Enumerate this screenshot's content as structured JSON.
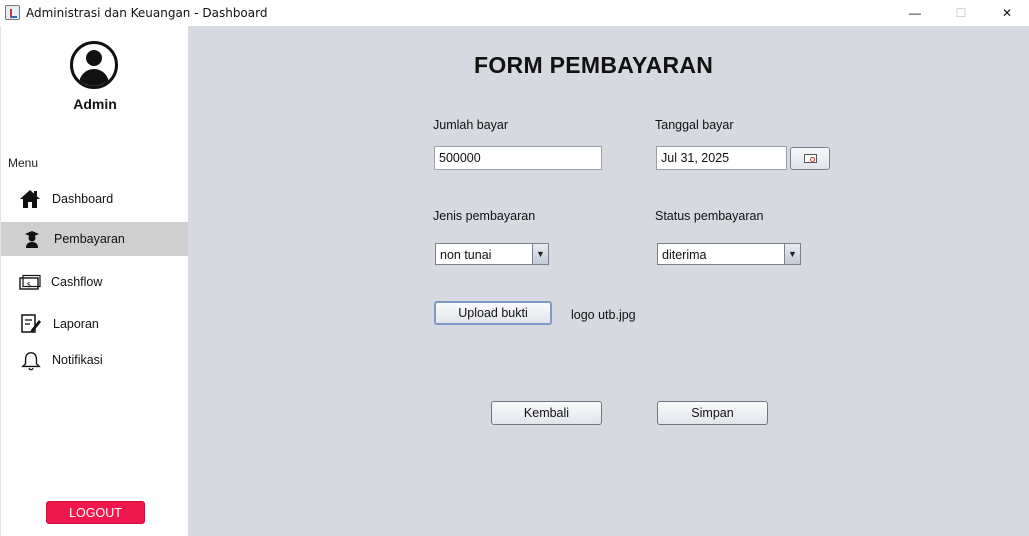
{
  "window": {
    "title": "Administrasi dan Keuangan - Dashboard",
    "controls": {
      "minimize": "—",
      "maximize": "☐",
      "close": "✕"
    }
  },
  "sidebar": {
    "user": {
      "name": "Admin",
      "avatar_icon": "user-circle-icon"
    },
    "menu_label": "Menu",
    "items": [
      {
        "label": "Dashboard",
        "icon": "home-icon",
        "active": false
      },
      {
        "label": "Pembayaran",
        "icon": "student-icon",
        "active": true
      },
      {
        "label": "Cashflow",
        "icon": "cash-icon",
        "active": false
      },
      {
        "label": "Laporan",
        "icon": "report-edit-icon",
        "active": false
      },
      {
        "label": "Notifikasi",
        "icon": "bell-icon",
        "active": false
      }
    ],
    "logout_label": "LOGOUT",
    "logout_color": "#f0174c",
    "active_bg": "#cfcfcf"
  },
  "form": {
    "title": "FORM PEMBAYARAN",
    "jumlah_bayar": {
      "label": "Jumlah bayar",
      "value": "500000"
    },
    "tanggal_bayar": {
      "label": "Tanggal bayar",
      "value": "Jul 31, 2025",
      "button_icon": "calendar-icon"
    },
    "jenis_pembayaran": {
      "label": "Jenis pembayaran",
      "value": "non tunai"
    },
    "status_pembayaran": {
      "label": "Status pembayaran",
      "value": "diterima"
    },
    "upload": {
      "button_label": "Upload bukti",
      "file_name": "logo utb.jpg"
    },
    "kembali_label": "Kembali",
    "simpan_label": "Simpan",
    "background": "#d6d9e0"
  }
}
